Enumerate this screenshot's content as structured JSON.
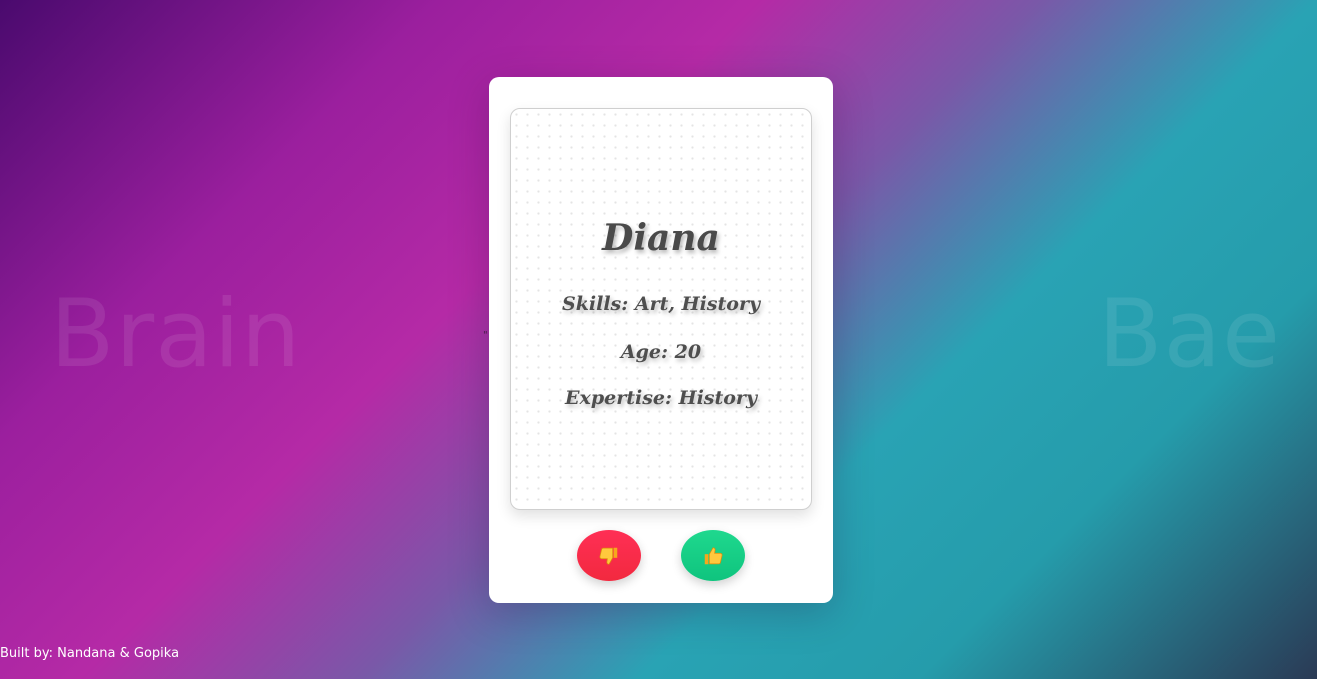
{
  "background_words": {
    "left": "Brain",
    "right": "Bae"
  },
  "profile": {
    "name": "Diana",
    "skills": "Skills: Art, History",
    "age": "Age: 20",
    "expertise": "Expertise: History"
  },
  "actions": {
    "dislike_icon": "thumbs-down-icon",
    "like_icon": "thumbs-up-icon"
  },
  "footer": {
    "credit": "Built by: Nandana & Gopika"
  },
  "colors": {
    "dislike": "#f2293f",
    "like": "#0fc47e",
    "card_text": "#4a4a4a"
  }
}
